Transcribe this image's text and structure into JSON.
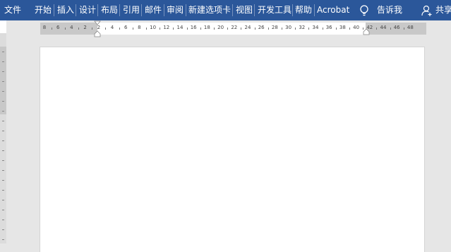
{
  "ribbon": {
    "tabs": [
      {
        "id": "file",
        "label": "文件"
      },
      {
        "id": "home",
        "label": "开始"
      },
      {
        "id": "insert",
        "label": "插入"
      },
      {
        "id": "design",
        "label": "设计"
      },
      {
        "id": "layout",
        "label": "布局"
      },
      {
        "id": "references",
        "label": "引用"
      },
      {
        "id": "mailings",
        "label": "邮件"
      },
      {
        "id": "review",
        "label": "审阅"
      },
      {
        "id": "new-tab",
        "label": "新建选项卡"
      },
      {
        "id": "view",
        "label": "视图"
      },
      {
        "id": "developer",
        "label": "开发工具"
      },
      {
        "id": "help",
        "label": "帮助"
      },
      {
        "id": "acrobat",
        "label": "Acrobat"
      }
    ],
    "tell_me": "告诉我",
    "share": "共享",
    "tell_me_icon": "lightbulb-icon",
    "share_icon": "person-add-icon",
    "colors": {
      "ribbon": "#2b579a",
      "workspace": "#e6e6e6",
      "page": "#ffffff"
    }
  },
  "ruler": {
    "labels": [
      "8",
      "6",
      "4",
      "2",
      "2",
      "4",
      "6",
      "8",
      "10",
      "12",
      "14",
      "16",
      "18",
      "20",
      "22",
      "24",
      "26",
      "28",
      "30",
      "32",
      "34",
      "36",
      "38",
      "40",
      "42",
      "44",
      "46",
      "48"
    ]
  }
}
